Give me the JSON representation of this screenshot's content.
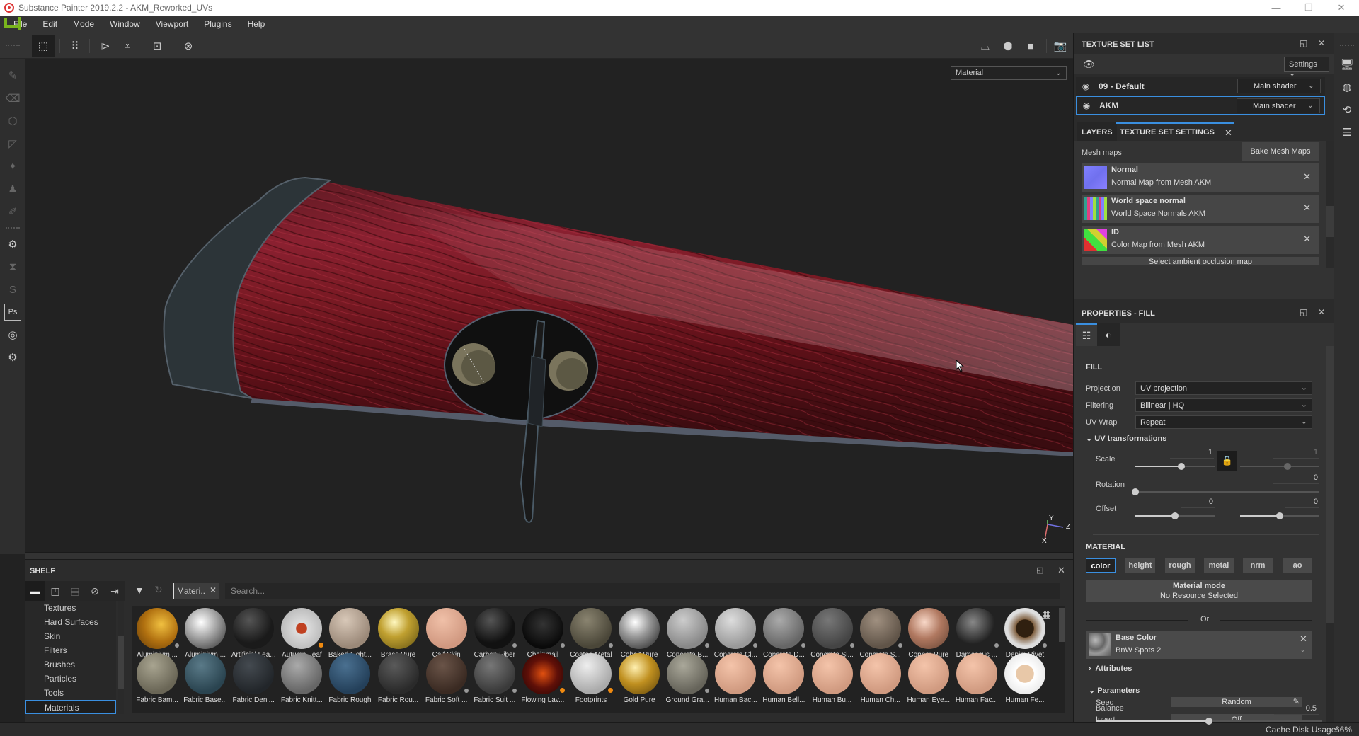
{
  "titlebar": {
    "title": "Substance Painter 2019.2.2 - AKM_Reworked_UVs",
    "minimize": "—",
    "restore": "❐",
    "close": "✕"
  },
  "menubar": {
    "items": [
      "File",
      "Edit",
      "Mode",
      "Window",
      "Viewport",
      "Plugins",
      "Help"
    ]
  },
  "toolbar": {
    "left_icons": [
      "rect-select-icon",
      "grid-select-icon",
      "symmetry-x-icon",
      "symmetry-y-icon",
      "add-frame-icon",
      "reset-icon"
    ],
    "glyphs": {
      "rect": "⬚",
      "grid": "⠿",
      "symx": "⧐",
      "symy": "⩡",
      "frame": "⊡",
      "reset": "⊗",
      "persp": "⏢",
      "cube": "⬢",
      "cam": "■",
      "shot": "📷"
    }
  },
  "lefttools": {
    "glyphs": [
      "✎",
      "⌫",
      "⬡",
      "◸",
      "✦",
      "♟",
      "✐",
      "⚙",
      "⧗",
      "S",
      "Ps",
      "◎",
      "⚙"
    ]
  },
  "viewport": {
    "channel_select": "Material",
    "axes": {
      "x": "X",
      "y": "Y",
      "z": "Z"
    }
  },
  "shelf": {
    "title": "SHELF",
    "filter_chip": "Materi..",
    "search_placeholder": "Search...",
    "categories": [
      "Textures",
      "Hard Surfaces",
      "Skin",
      "Filters",
      "Brushes",
      "Particles",
      "Tools",
      "Materials"
    ],
    "selected_category": "Materials",
    "row1": [
      {
        "label": "Aluminium ...",
        "badge": "dots"
      },
      {
        "label": "Aluminium ...",
        "badge": ""
      },
      {
        "label": "Artificial Lea...",
        "badge": ""
      },
      {
        "label": "Autumn Leaf",
        "badge": "orange"
      },
      {
        "label": "Baked Light...",
        "badge": ""
      },
      {
        "label": "Brass Pure",
        "badge": ""
      },
      {
        "label": "Calf Skin",
        "badge": ""
      },
      {
        "label": "Carbon Fiber",
        "badge": "dots"
      },
      {
        "label": "Chainmail",
        "badge": "dots"
      },
      {
        "label": "Coated Metal",
        "badge": "dots"
      },
      {
        "label": "Cobalt Pure",
        "badge": ""
      },
      {
        "label": "Concrete B...",
        "badge": "dots"
      },
      {
        "label": "Concrete Cl...",
        "badge": "dots"
      },
      {
        "label": "Concrete D...",
        "badge": "dots"
      },
      {
        "label": "Concrete Si...",
        "badge": "dots"
      },
      {
        "label": "Concrete S...",
        "badge": "dots"
      },
      {
        "label": "Copper Pure",
        "badge": ""
      },
      {
        "label": "Damascus ...",
        "badge": "dots"
      },
      {
        "label": "Denim Rivet",
        "badge": "dots"
      }
    ],
    "row2": [
      {
        "label": "Fabric Bam...",
        "badge": ""
      },
      {
        "label": "Fabric Base...",
        "badge": ""
      },
      {
        "label": "Fabric Deni...",
        "badge": ""
      },
      {
        "label": "Fabric Knitt...",
        "badge": ""
      },
      {
        "label": "Fabric Rough",
        "badge": ""
      },
      {
        "label": "Fabric Rou...",
        "badge": ""
      },
      {
        "label": "Fabric Soft ...",
        "badge": "dots"
      },
      {
        "label": "Fabric Suit ...",
        "badge": "dots"
      },
      {
        "label": "Flowing Lav...",
        "badge": "orange"
      },
      {
        "label": "Footprints",
        "badge": "orange"
      },
      {
        "label": "Gold Pure",
        "badge": ""
      },
      {
        "label": "Ground Gra...",
        "badge": "dots"
      },
      {
        "label": "Human Bac...",
        "badge": ""
      },
      {
        "label": "Human Bell...",
        "badge": ""
      },
      {
        "label": "Human Bu...",
        "badge": ""
      },
      {
        "label": "Human Ch...",
        "badge": ""
      },
      {
        "label": "Human Eye...",
        "badge": ""
      },
      {
        "label": "Human Fac...",
        "badge": ""
      },
      {
        "label": "Human Fe...",
        "badge": ""
      }
    ]
  },
  "texture_set_list": {
    "title": "TEXTURE SET LIST",
    "settings_label": "Settings",
    "rows": [
      {
        "name": "09 - Default",
        "shader": "Main shader",
        "selected": false
      },
      {
        "name": "AKM",
        "shader": "Main shader",
        "selected": true
      }
    ]
  },
  "tabs": {
    "layers": "LAYERS",
    "tss": "TEXTURE SET SETTINGS"
  },
  "texture_set_settings": {
    "mesh_maps_label": "Mesh maps",
    "bake_button": "Bake Mesh Maps",
    "maps": [
      {
        "name": "Normal",
        "source": "Normal Map from Mesh AKM"
      },
      {
        "name": "World space normal",
        "source": "World Space Normals AKM"
      },
      {
        "name": "ID",
        "source": "Color Map from Mesh AKM"
      }
    ],
    "select_ao": "Select ambient occlusion map"
  },
  "properties": {
    "title": "PROPERTIES - FILL",
    "fill_section": "FILL",
    "projection_label": "Projection",
    "projection_value": "UV projection",
    "filtering_label": "Filtering",
    "filtering_value": "Bilinear | HQ",
    "uvwrap_label": "UV Wrap",
    "uvwrap_value": "Repeat",
    "uv_transform_section": "UV transformations",
    "scale_label": "Scale",
    "scale_u": "1",
    "scale_v": "1",
    "rotation_label": "Rotation",
    "rotation_value": "0",
    "offset_label": "Offset",
    "offset_u": "0",
    "offset_v": "0",
    "slider_levels": {
      "scale_u": 0.58,
      "scale_v": 0.6,
      "rotation": 0.0,
      "offset_u": 0.5,
      "offset_v": 0.5,
      "balance": 0.5
    },
    "material_section": "MATERIAL",
    "channels": [
      "color",
      "height",
      "rough",
      "metal",
      "nrm",
      "ao"
    ],
    "selected_channel": "color",
    "material_mode_title": "Material mode",
    "material_mode_value": "No Resource Selected",
    "or_label": "Or",
    "base_color_title": "Base Color",
    "base_color_value": "BnW Spots 2",
    "attributes_label": "Attributes",
    "parameters_label": "Parameters",
    "seed_label": "Seed",
    "seed_value": "Random",
    "invert_label": "Invert",
    "invert_value": "Off",
    "balance_label": "Balance",
    "balance_value": "0.5"
  },
  "statusbar": {
    "cache_label": "Cache Disk Usage:",
    "cache_value": "66%"
  },
  "colors": {
    "accent": "#3a8fe0",
    "brand": "#7ab51d",
    "wood": "#7a1520"
  }
}
